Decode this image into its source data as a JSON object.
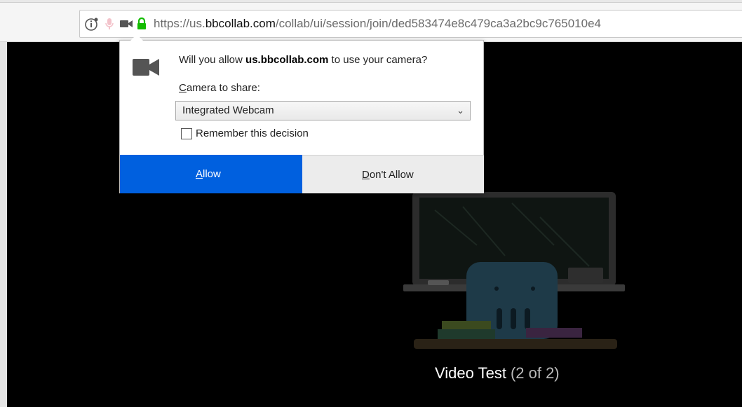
{
  "browser": {
    "url_prefix": "https://us.",
    "url_host": "bbcollab.com",
    "url_path": "/collab/ui/session/join/ded583474e8c479ca3a2bc9c765010e4",
    "icons": [
      "info-icon",
      "microphone-icon",
      "camera-icon",
      "lock-icon"
    ]
  },
  "permission_popup": {
    "question_prefix": "Will you allow ",
    "question_host": "us.bbcollab.com",
    "question_suffix": " to use your camera?",
    "camera_label_accesskey": "C",
    "camera_label_rest": "amera to share:",
    "selected_camera": "Integrated Webcam",
    "remember_label": "Remember this decision",
    "remember_checked": false,
    "allow_accesskey": "A",
    "allow_rest": "llow",
    "deny_accesskey": "D",
    "deny_rest": "on't Allow",
    "allow_color": "#0060df"
  },
  "page": {
    "video_test_title": "Video Test",
    "video_test_progress": "(2 of 2)"
  }
}
